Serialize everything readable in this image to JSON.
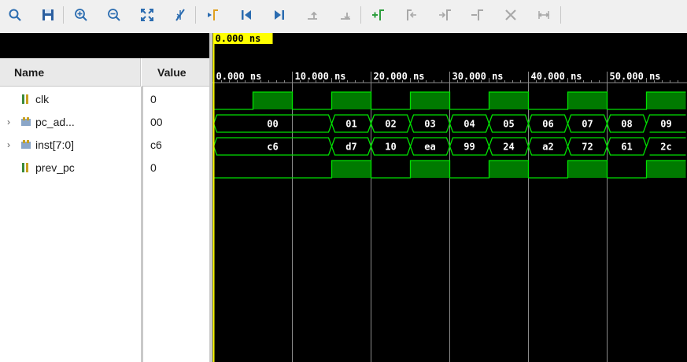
{
  "toolbar": {
    "buttons": [
      {
        "icon": "search-icon",
        "enabled": true
      },
      {
        "icon": "save-icon",
        "enabled": true
      },
      {
        "icon": "zoom-in-icon",
        "enabled": true
      },
      {
        "icon": "zoom-out-icon",
        "enabled": true
      },
      {
        "icon": "zoom-fit-icon",
        "enabled": true
      },
      {
        "icon": "go-to-cursor-icon",
        "enabled": true
      },
      {
        "icon": "go-to-zero-icon",
        "enabled": true
      },
      {
        "icon": "go-to-first-icon",
        "enabled": true
      },
      {
        "icon": "go-to-last-icon",
        "enabled": true
      },
      {
        "icon": "swap-up-icon",
        "enabled": false
      },
      {
        "icon": "swap-down-icon",
        "enabled": false
      },
      {
        "icon": "add-marker-icon",
        "enabled": true
      },
      {
        "icon": "previous-marker-icon",
        "enabled": false
      },
      {
        "icon": "next-marker-icon",
        "enabled": false
      },
      {
        "icon": "snap-to-transition-icon",
        "enabled": false
      },
      {
        "icon": "delete-marker-icon",
        "enabled": false
      },
      {
        "icon": "floating-ruler-icon",
        "enabled": false
      }
    ]
  },
  "columns": {
    "name": "Name",
    "value": "Value"
  },
  "signals": [
    {
      "name": "clk",
      "value": "0",
      "type": "bit",
      "expandable": false
    },
    {
      "name": "pc_ad...",
      "value": "00",
      "type": "bus",
      "expandable": true
    },
    {
      "name": "inst[7:0]",
      "value": "c6",
      "type": "bus",
      "expandable": true
    },
    {
      "name": "prev_pc",
      "value": "0",
      "type": "bit",
      "expandable": false
    }
  ],
  "cursor": {
    "time_ns": 0,
    "label": "0.000 ns"
  },
  "ruler": {
    "ticks": [
      "0.000 ns",
      "10.000 ns",
      "20.000 ns",
      "30.000 ns",
      "40.000 ns",
      "50.000 ns"
    ],
    "major_step_ns": 10,
    "visible_range_ns": [
      0,
      60
    ]
  },
  "waveforms": {
    "clk": {
      "period_ns": 10,
      "high_intervals_ns": [
        [
          5,
          10
        ],
        [
          15,
          20
        ],
        [
          25,
          30
        ],
        [
          35,
          40
        ],
        [
          45,
          50
        ],
        [
          55,
          60
        ]
      ]
    },
    "pc_ad...": {
      "segments": [
        {
          "start": 0,
          "end": 15,
          "value": "00"
        },
        {
          "start": 15,
          "end": 20,
          "value": "01"
        },
        {
          "start": 20,
          "end": 25,
          "value": "02"
        },
        {
          "start": 25,
          "end": 30,
          "value": "03"
        },
        {
          "start": 30,
          "end": 35,
          "value": "04"
        },
        {
          "start": 35,
          "end": 40,
          "value": "05"
        },
        {
          "start": 40,
          "end": 45,
          "value": "06"
        },
        {
          "start": 45,
          "end": 50,
          "value": "07"
        },
        {
          "start": 50,
          "end": 55,
          "value": "08"
        },
        {
          "start": 55,
          "end": 60,
          "value": "09"
        }
      ]
    },
    "inst[7:0]": {
      "segments": [
        {
          "start": 0,
          "end": 15,
          "value": "c6"
        },
        {
          "start": 15,
          "end": 20,
          "value": "d7"
        },
        {
          "start": 20,
          "end": 25,
          "value": "10"
        },
        {
          "start": 25,
          "end": 30,
          "value": "ea"
        },
        {
          "start": 30,
          "end": 35,
          "value": "99"
        },
        {
          "start": 35,
          "end": 40,
          "value": "24"
        },
        {
          "start": 40,
          "end": 45,
          "value": "a2"
        },
        {
          "start": 45,
          "end": 50,
          "value": "72"
        },
        {
          "start": 50,
          "end": 55,
          "value": "61"
        },
        {
          "start": 55,
          "end": 60,
          "value": "2c"
        }
      ]
    },
    "prev_pc": {
      "high_intervals_ns": [
        [
          15,
          20
        ],
        [
          25,
          30
        ],
        [
          35,
          40
        ],
        [
          45,
          50
        ],
        [
          55,
          60
        ]
      ]
    }
  },
  "colors": {
    "wave": "#00e000",
    "wave_fill": "#007a00",
    "bus_text": "#ffffff",
    "grid": "#8a8a8a",
    "cursor": "#ffff00",
    "cursor_label_bg": "#ffff00",
    "ruler_text": "#ffffff",
    "toolbar_icon": "#2b6cb0",
    "toolbar_icon_green": "#2e9e3e",
    "toolbar_icon_disabled": "#a8a8a8"
  }
}
